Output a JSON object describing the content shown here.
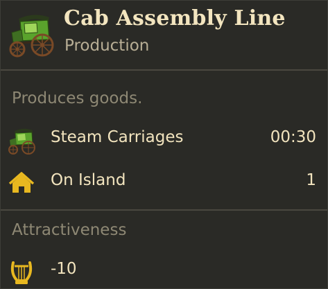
{
  "header": {
    "icon": "steam-carriage-icon",
    "title": "Cab Assembly Line",
    "subtitle": "Production"
  },
  "production": {
    "section_label": "Produces goods.",
    "product": {
      "icon": "steam-carriage-icon",
      "label": "Steam Carriages",
      "value": "00:30"
    },
    "location": {
      "icon": "home-icon",
      "label": "On Island",
      "value": "1"
    }
  },
  "attractiveness": {
    "section_label": "Attractiveness",
    "icon": "lyre-icon",
    "value": "-10"
  },
  "colors": {
    "background": "#2a2a26",
    "title": "#f3e5bf",
    "subtitle": "#b8ae95",
    "section_label": "#8e8874",
    "accent_gold": "#e8b820"
  }
}
